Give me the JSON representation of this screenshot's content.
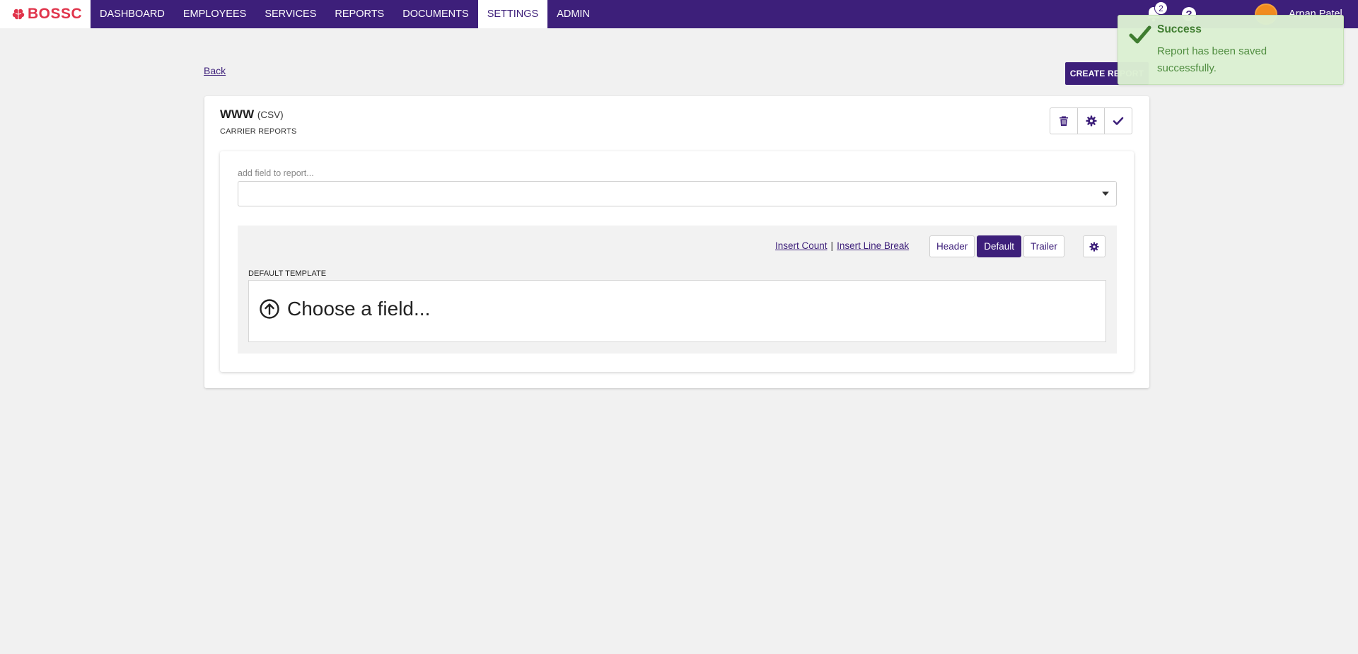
{
  "app": {
    "logo_text": "BOSSC"
  },
  "nav": {
    "items": [
      {
        "label": "DASHBOARD",
        "active": false
      },
      {
        "label": "EMPLOYEES",
        "active": false
      },
      {
        "label": "SERVICES",
        "active": false
      },
      {
        "label": "REPORTS",
        "active": false
      },
      {
        "label": "DOCUMENTS",
        "active": false
      },
      {
        "label": "SETTINGS",
        "active": true
      },
      {
        "label": "ADMIN",
        "active": false
      }
    ],
    "notification_count": "2",
    "help_label": "?",
    "user_name": "Arpan Patel"
  },
  "page": {
    "back_label": "Back",
    "create_button_label": "CREATE REPORT"
  },
  "report": {
    "name": "WWW",
    "format": "(CSV)",
    "category": "CARRIER REPORTS",
    "field_picker_placeholder": "add field to report...",
    "insert_count_label": "Insert Count",
    "separator": "|",
    "insert_line_break_label": "Insert Line Break",
    "template_tabs": [
      {
        "label": "Header",
        "active": false
      },
      {
        "label": "Default",
        "active": true
      },
      {
        "label": "Trailer",
        "active": false
      }
    ],
    "template_label": "DEFAULT TEMPLATE",
    "choose_field_label": "Choose a field..."
  },
  "toast": {
    "title": "Success",
    "message": "Report has been saved successfully."
  },
  "colors": {
    "brand_purple": "#3d1f7a",
    "logo_red": "#e0344b",
    "success_bg": "#dcf0d3",
    "success_text": "#3a7a2a"
  }
}
